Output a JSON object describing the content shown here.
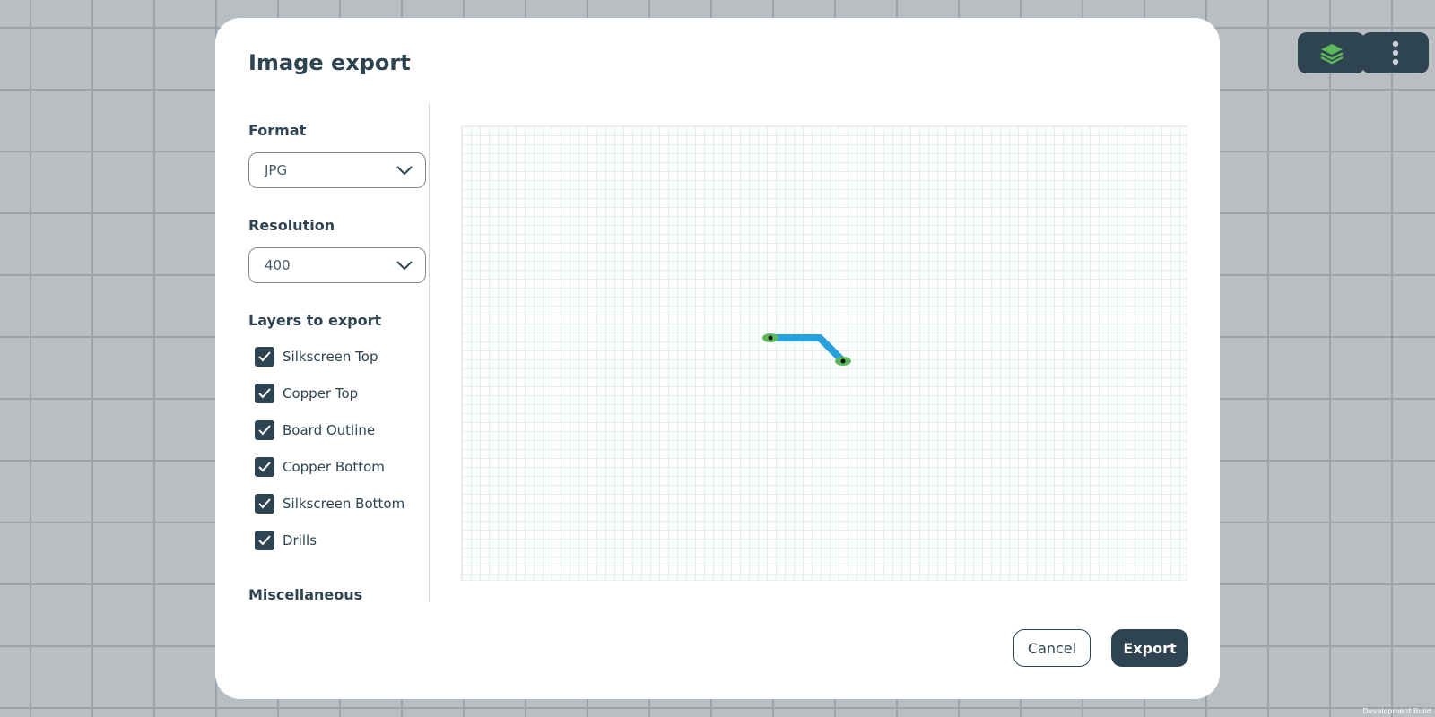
{
  "dialog": {
    "title": "Image export",
    "format": {
      "label": "Format",
      "value": "JPG"
    },
    "resolution": {
      "label": "Resolution",
      "value": "400"
    },
    "layers": {
      "label": "Layers to export",
      "items": [
        {
          "label": "Silkscreen Top",
          "checked": true
        },
        {
          "label": "Copper Top",
          "checked": true
        },
        {
          "label": "Board Outline",
          "checked": true
        },
        {
          "label": "Copper Bottom",
          "checked": true
        },
        {
          "label": "Silkscreen Bottom",
          "checked": true
        },
        {
          "label": "Drills",
          "checked": true
        }
      ]
    },
    "misc_label": "Miscellaneous",
    "cancel_label": "Cancel",
    "export_label": "Export"
  },
  "toolbar": {
    "layers_icon": "layers-icon",
    "more_icon": "more-vertical-icon"
  },
  "footer": {
    "build_label": "Development Build"
  },
  "colors": {
    "primary": "#2f4451",
    "trace": "#27a0dc",
    "pad": "#5cb85c",
    "layers_icon": "#5cb85c"
  }
}
